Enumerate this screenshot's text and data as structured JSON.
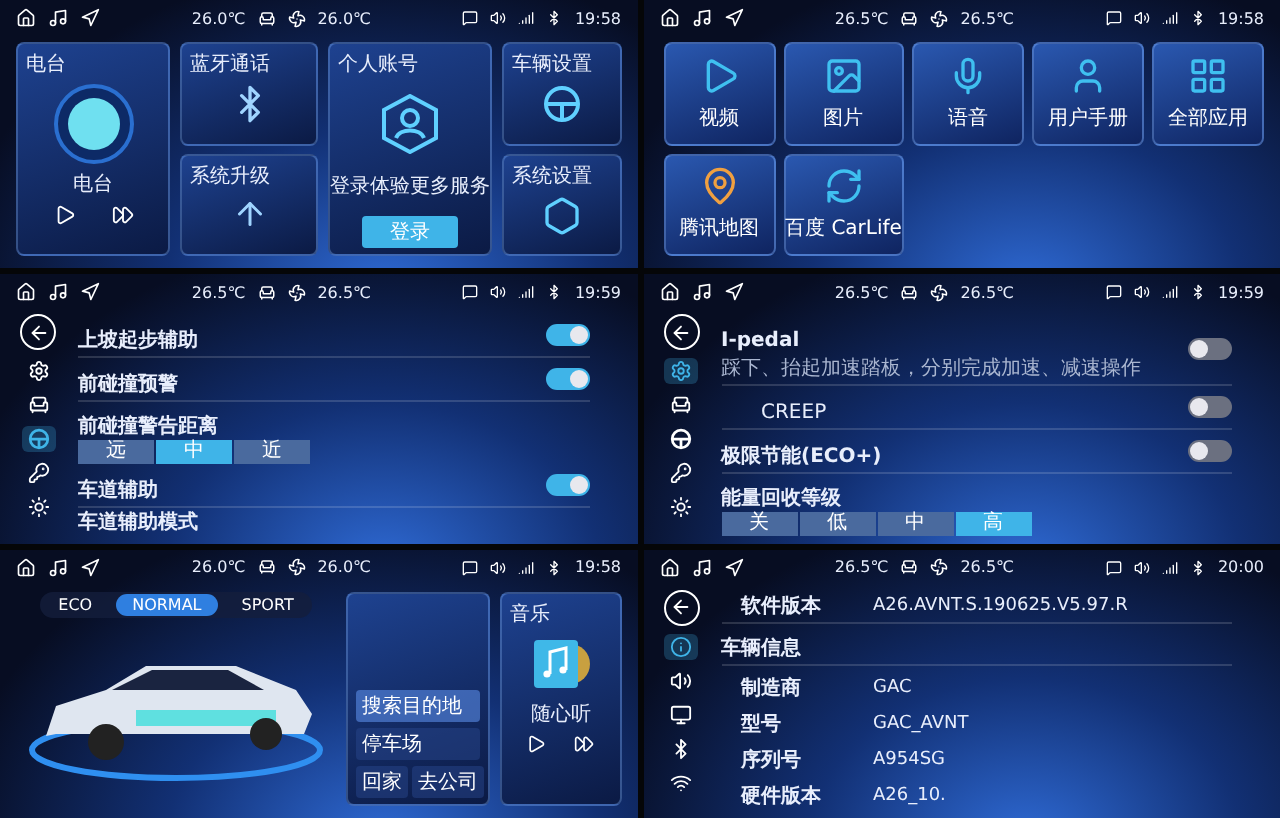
{
  "screens": [
    {
      "kind": "home",
      "status": {
        "temp_left": "26.0℃",
        "temp_right": "26.0℃",
        "time": "19:58"
      },
      "radio": {
        "title": "电台",
        "label": "电台"
      },
      "tiles": [
        {
          "kind": "bluetooth",
          "title": "蓝牙通话"
        },
        {
          "kind": "upgrade",
          "title": "系统升级"
        }
      ],
      "account": {
        "title": "个人账号",
        "message": "登录体验更多服务",
        "button": "登录"
      },
      "side_tiles": [
        {
          "kind": "wheel",
          "title": "车辆设置"
        },
        {
          "kind": "hexagon",
          "title": "系统设置"
        }
      ]
    },
    {
      "kind": "apps",
      "status": {
        "temp_left": "26.5℃",
        "temp_right": "26.5℃",
        "time": "19:58"
      },
      "apps": [
        {
          "kind": "video",
          "label": "视频"
        },
        {
          "kind": "image",
          "label": "图片"
        },
        {
          "kind": "mic",
          "label": "语音"
        },
        {
          "kind": "user",
          "label": "用户手册"
        },
        {
          "kind": "grid",
          "label": "全部应用"
        },
        {
          "kind": "map",
          "label": "腾讯地图"
        },
        {
          "kind": "carlife",
          "label": "百度 CarLife"
        }
      ]
    },
    {
      "kind": "settings",
      "status": {
        "temp_left": "26.5℃",
        "temp_right": "26.5℃",
        "time": "19:59"
      },
      "sidebar": [
        {
          "kind": "gear",
          "selected": false
        },
        {
          "kind": "seat",
          "selected": false
        },
        {
          "kind": "wheel",
          "selected": true
        },
        {
          "kind": "key",
          "selected": false
        },
        {
          "kind": "sun",
          "selected": false
        }
      ],
      "rows": [
        {
          "kind": "toggle",
          "title": "上坡起步辅助",
          "on": true
        },
        {
          "kind": "toggle",
          "title": "前碰撞预警",
          "on": true
        },
        {
          "kind": "segment",
          "title": "前碰撞警告距离",
          "options": [
            {
              "label": "远",
              "selected": false
            },
            {
              "label": "中",
              "selected": true
            },
            {
              "label": "近",
              "selected": false
            }
          ]
        },
        {
          "kind": "toggle",
          "title": "车道辅助",
          "on": true
        },
        {
          "kind": "heading",
          "title": "车道辅助模式"
        }
      ]
    },
    {
      "kind": "settings",
      "status": {
        "temp_left": "26.5℃",
        "temp_right": "26.5℃",
        "time": "19:59"
      },
      "sidebar": [
        {
          "kind": "gear",
          "selected": true
        },
        {
          "kind": "seat",
          "selected": false
        },
        {
          "kind": "wheel",
          "selected": false
        },
        {
          "kind": "key",
          "selected": false
        },
        {
          "kind": "sun",
          "selected": false
        }
      ],
      "rows": [
        {
          "kind": "toggle",
          "title": "I-pedal",
          "description": "踩下、抬起加速踏板，分别完成加速、减速操作",
          "on": false
        },
        {
          "kind": "toggle",
          "title": "CREEP",
          "on": false,
          "indented": true
        },
        {
          "kind": "toggle",
          "title": "极限节能(ECO+)",
          "on": false
        },
        {
          "kind": "segment",
          "title": "能量回收等级",
          "options": [
            {
              "label": "关",
              "selected": false
            },
            {
              "label": "低",
              "selected": false
            },
            {
              "label": "中",
              "selected": false
            },
            {
              "label": "高",
              "selected": true
            }
          ]
        }
      ]
    },
    {
      "kind": "drive",
      "status": {
        "temp_left": "26.0℃",
        "temp_right": "26.0℃",
        "time": "19:58"
      },
      "modes": [
        {
          "label": "ECO",
          "selected": false
        },
        {
          "label": "NORMAL",
          "selected": true
        },
        {
          "label": "SPORT",
          "selected": false
        }
      ],
      "nav": {
        "search": "搜索目的地",
        "parking": "停车场",
        "home": "回家",
        "work": "去公司"
      },
      "music": {
        "title": "音乐",
        "track": "随心听"
      }
    },
    {
      "kind": "info",
      "status": {
        "temp_left": "26.5℃",
        "temp_right": "26.5℃",
        "time": "20:00"
      },
      "sidebar": [
        {
          "kind": "info",
          "selected": true
        },
        {
          "kind": "sound",
          "selected": false
        },
        {
          "kind": "display",
          "selected": false
        },
        {
          "kind": "bluetooth",
          "selected": false
        },
        {
          "kind": "wifi",
          "selected": false
        }
      ],
      "software": {
        "label": "软件版本",
        "value": "A26.AVNT.S.190625.V5.97.R"
      },
      "heading": "车辆信息",
      "fields": [
        {
          "label": "制造商",
          "value": "GAC"
        },
        {
          "label": "型号",
          "value": "GAC_AVNT"
        },
        {
          "label": "序列号",
          "value": "A954SG"
        },
        {
          "label": "硬件版本",
          "value": "A26_10."
        }
      ]
    }
  ]
}
